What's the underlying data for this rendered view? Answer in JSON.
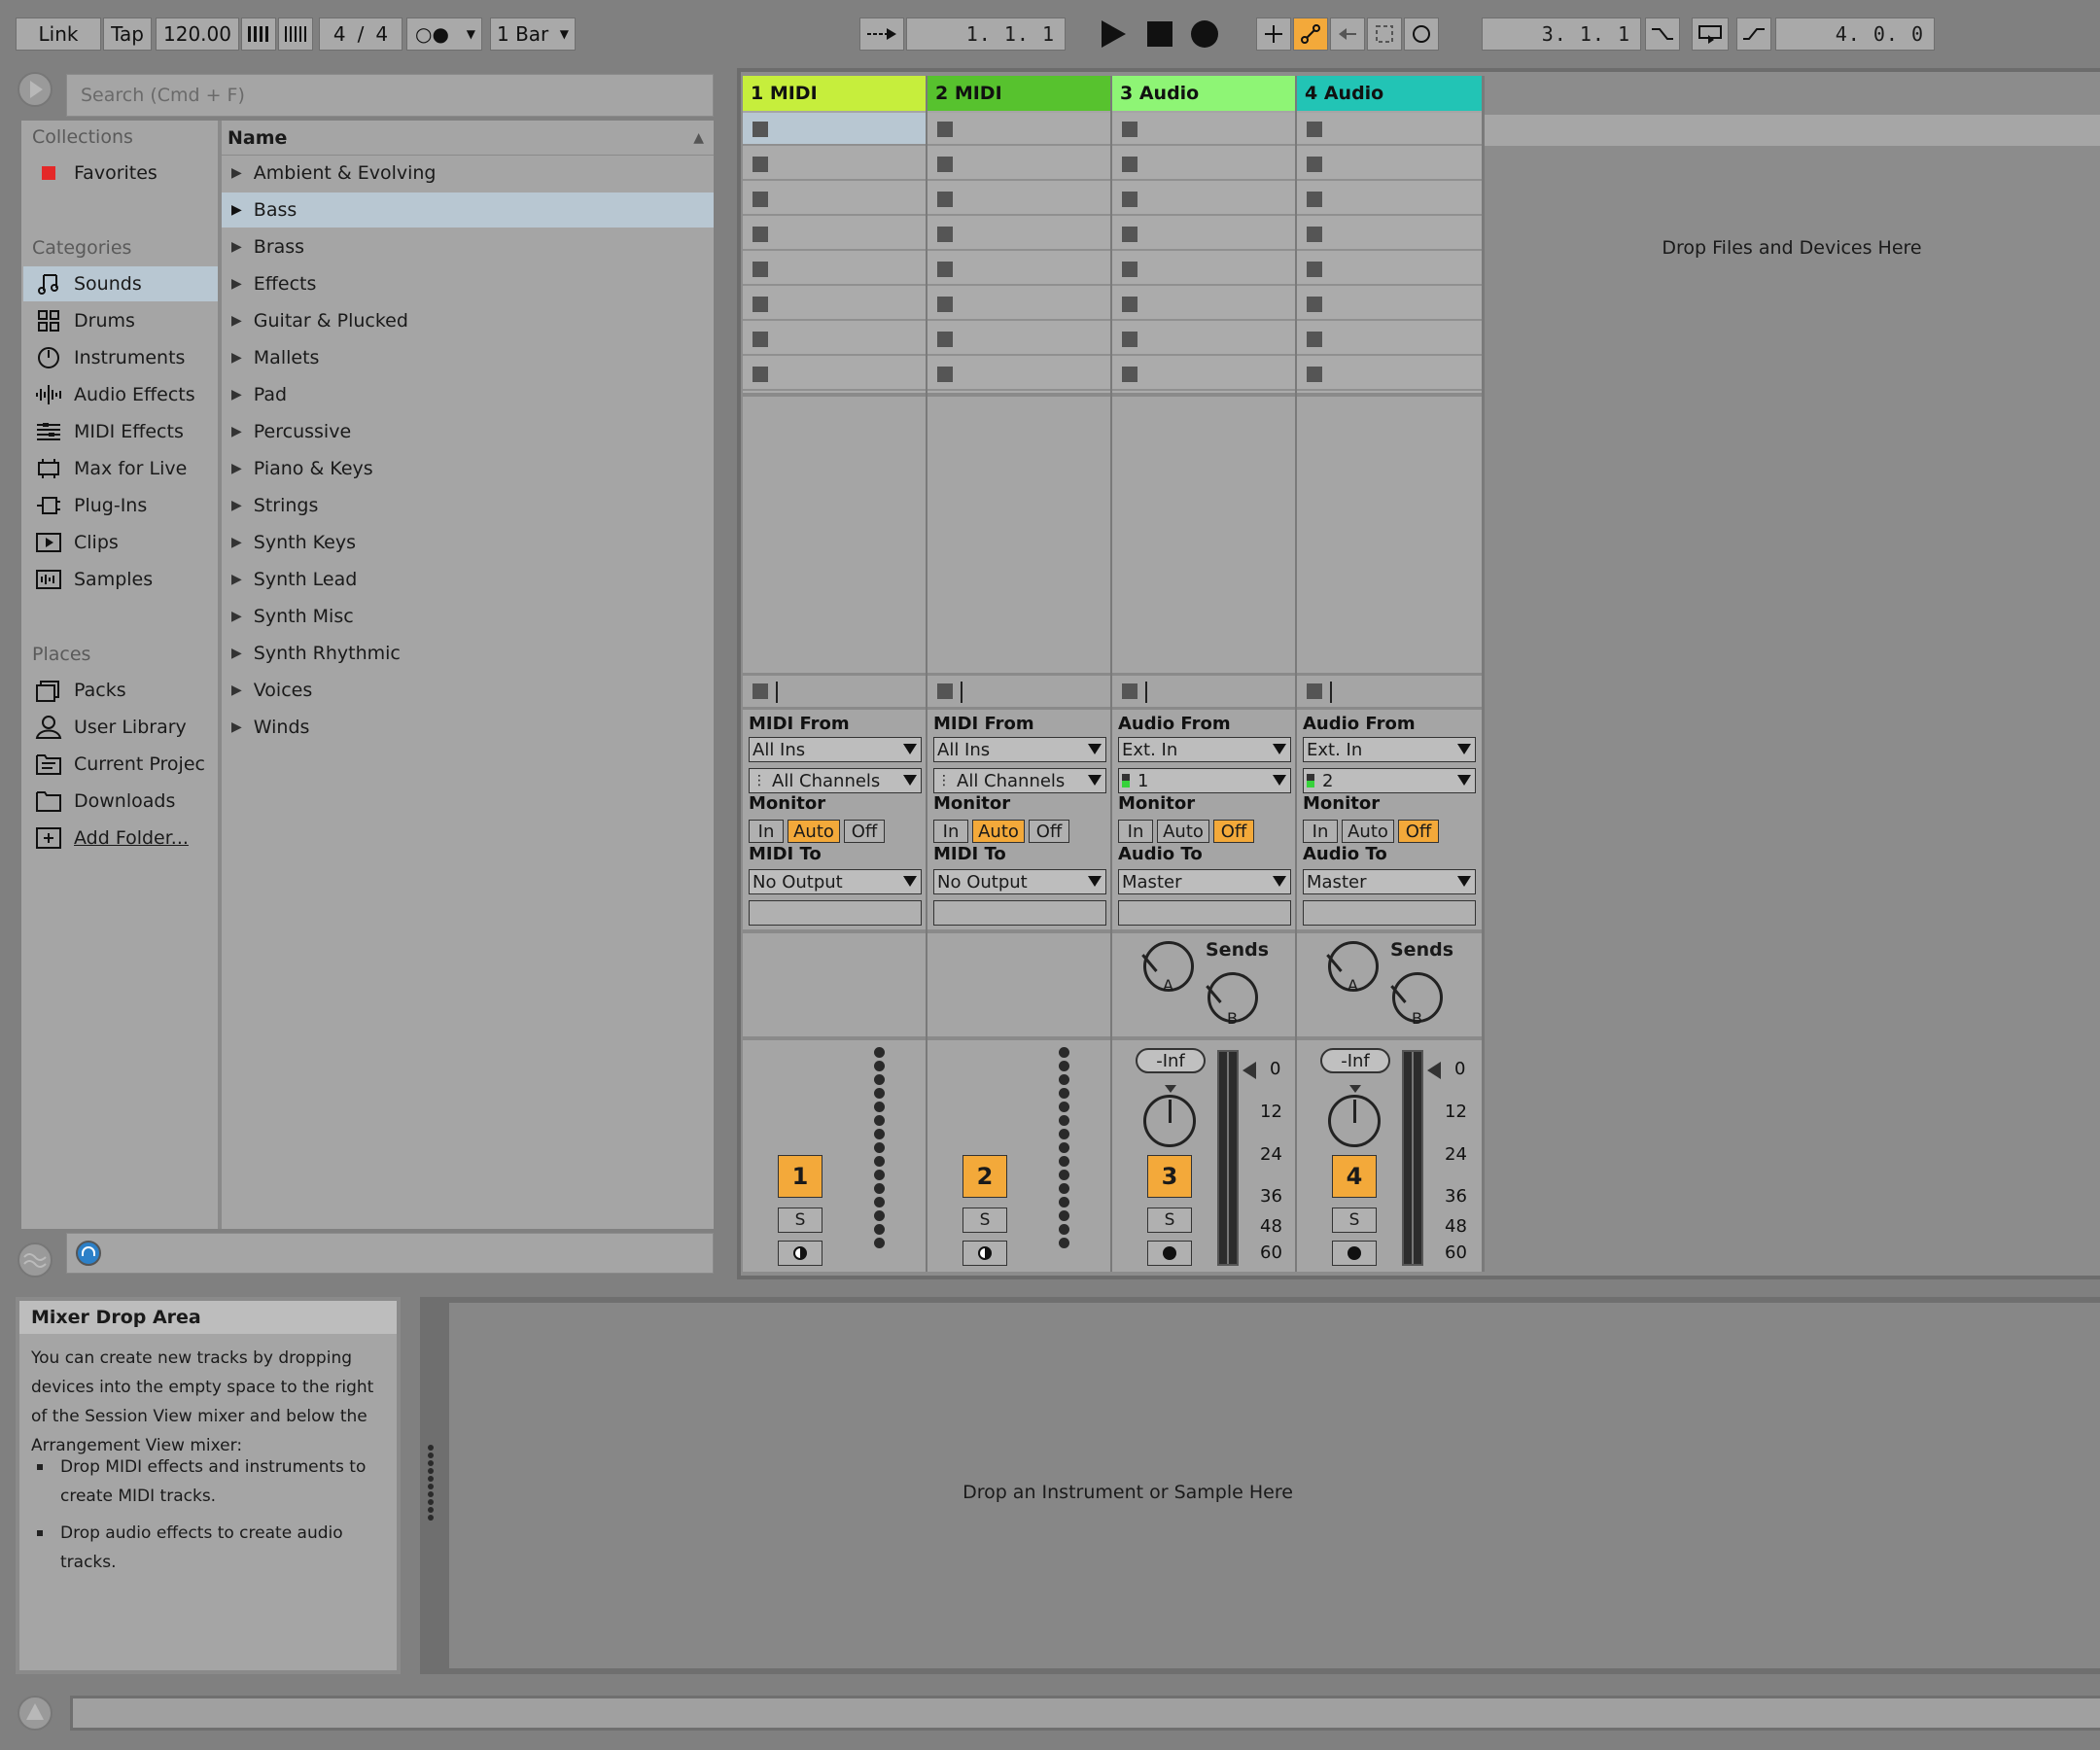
{
  "transport": {
    "link": "Link",
    "tap": "Tap",
    "tempo": "120.00",
    "sig_num": "4",
    "sig_slash": "/",
    "sig_den": "4",
    "metro": "○●",
    "quantize": "1 Bar",
    "position": "1.  1.  1",
    "loop_start": "3.  1.  1",
    "loop_length": "4.  0.  0"
  },
  "browser": {
    "search_placeholder": "Search (Cmd + F)",
    "collections_title": "Collections",
    "favorites": "Favorites",
    "categories_title": "Categories",
    "categories": [
      "Sounds",
      "Drums",
      "Instruments",
      "Audio Effects",
      "MIDI Effects",
      "Max for Live",
      "Plug-Ins",
      "Clips",
      "Samples"
    ],
    "places_title": "Places",
    "places": [
      "Packs",
      "User Library",
      "Current Projec",
      "Downloads",
      "Add Folder..."
    ],
    "name_header": "Name",
    "items": [
      "Ambient & Evolving",
      "Bass",
      "Brass",
      "Effects",
      "Guitar & Plucked",
      "Mallets",
      "Pad",
      "Percussive",
      "Piano & Keys",
      "Strings",
      "Synth Keys",
      "Synth Lead",
      "Synth Misc",
      "Synth Rhythmic",
      "Voices",
      "Winds"
    ]
  },
  "tracks": [
    {
      "name": "1 MIDI",
      "color": "#c6ee3c",
      "from_label": "MIDI From",
      "from": "All Ins",
      "channel": "All Channels",
      "to_label": "MIDI To",
      "to": "No Output",
      "number": "1",
      "solo": "S"
    },
    {
      "name": "2 MIDI",
      "color": "#57c22e",
      "from_label": "MIDI From",
      "from": "All Ins",
      "channel": "All Channels",
      "to_label": "MIDI To",
      "to": "No Output",
      "number": "2",
      "solo": "S"
    },
    {
      "name": "3 Audio",
      "color": "#8ef575",
      "from_label": "Audio From",
      "from": "Ext. In",
      "channel": "1",
      "to_label": "Audio To",
      "to": "Master",
      "number": "3",
      "solo": "S",
      "volume": "-Inf",
      "sends": "Sends"
    },
    {
      "name": "4 Audio",
      "color": "#22c4b5",
      "from_label": "Audio From",
      "from": "Ext. In",
      "channel": "2",
      "to_label": "Audio To",
      "to": "Master",
      "number": "4",
      "solo": "S",
      "volume": "-Inf",
      "sends": "Sends"
    }
  ],
  "monitor": {
    "label": "Monitor",
    "in": "In",
    "auto": "Auto",
    "off": "Off"
  },
  "sends": {
    "a": "A",
    "b": "B"
  },
  "meter_scale": [
    "0",
    "12",
    "24",
    "36",
    "48",
    "60"
  ],
  "session_drop": "Drop Files and Devices Here",
  "device_drop": "Drop an Instrument or Sample Here",
  "info": {
    "title": "Mixer Drop Area",
    "body": "You can create new tracks by dropping devices into the empty space to the right of the Session View mixer and below the Arrangement View mixer:",
    "bullet1": "Drop MIDI effects and instruments to create MIDI tracks.",
    "bullet2": "Drop audio effects to create audio tracks."
  }
}
